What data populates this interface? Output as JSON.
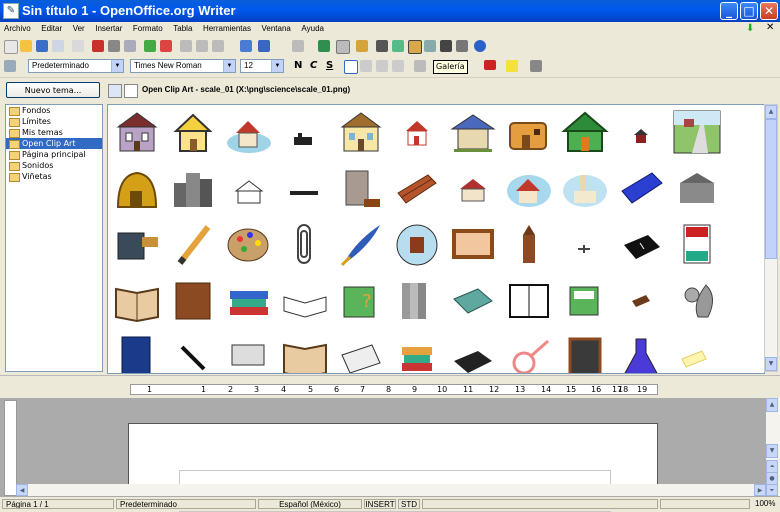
{
  "window": {
    "title": "Sin título 1 - OpenOffice.org Writer"
  },
  "menu": [
    "Archivo",
    "Editar",
    "Ver",
    "Insertar",
    "Formato",
    "Tabla",
    "Herramientas",
    "Ventana",
    "Ayuda"
  ],
  "format_bar": {
    "style": "Predeterminado",
    "font": "Times New Roman",
    "size": "12",
    "bold": "N",
    "italic": "C",
    "underline": "S"
  },
  "tooltip": "Galería",
  "gallery": {
    "new_theme_label": "Nuevo tema...",
    "path": "Open Clip Art - scale_01 (X:\\png\\science\\scale_01.png)",
    "themes": [
      "Fondos",
      "Límites",
      "Mis temas",
      "Open Clip Art",
      "Página principal",
      "Sonidos",
      "Viñetas"
    ],
    "selected_theme": "Open Clip Art"
  },
  "ruler": {
    "labels": [
      "1",
      "1",
      "2",
      "3",
      "4",
      "5",
      "6",
      "7",
      "8",
      "9",
      "10",
      "11",
      "12",
      "13",
      "14",
      "15",
      "16",
      "17",
      "18",
      "19"
    ]
  },
  "status": {
    "page": "Página 1 / 1",
    "style": "Predeterminado",
    "language": "Español (México)",
    "insert": "INSERT",
    "std": "STD",
    "zoom": "100%"
  },
  "colors": {
    "titlebar": "#0058EE",
    "selection": "#316AC5",
    "chrome": "#ECE9D8"
  }
}
